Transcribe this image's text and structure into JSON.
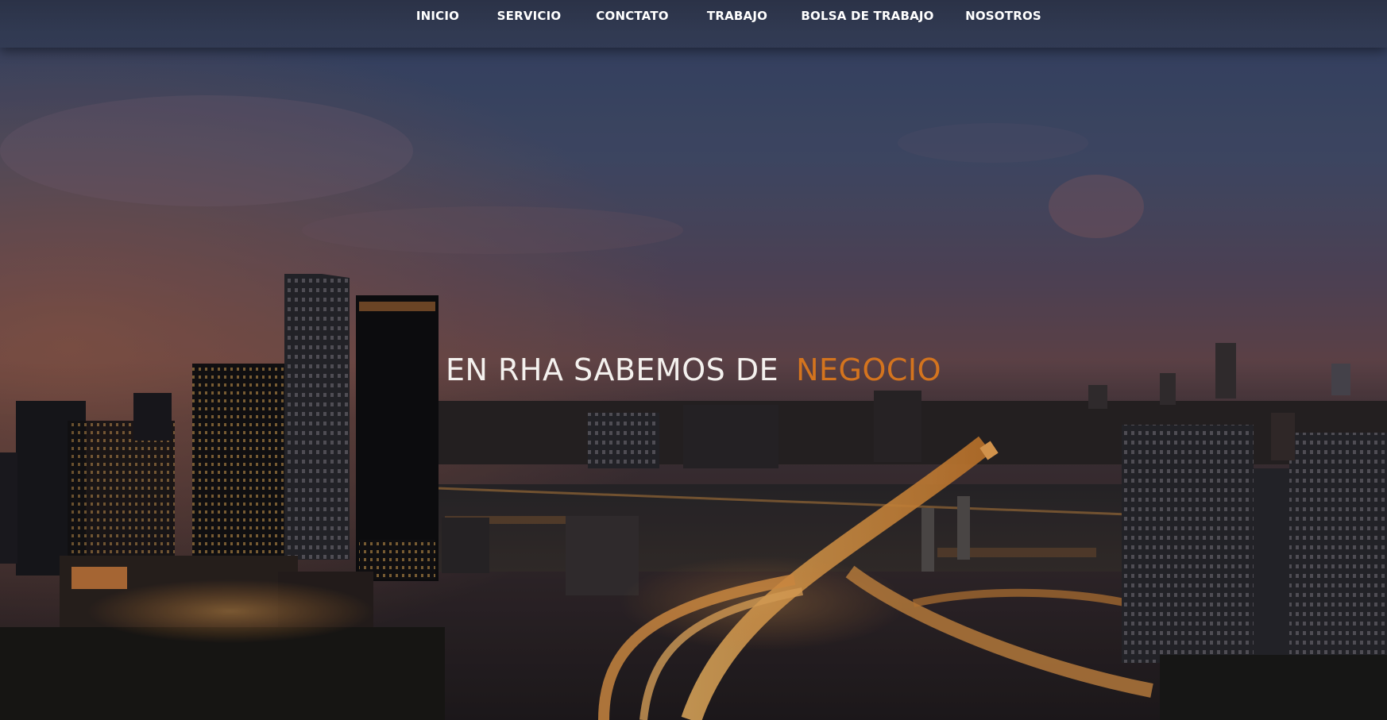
{
  "nav": {
    "items": [
      {
        "label": "INICIO"
      },
      {
        "label": "SERVICIO"
      },
      {
        "label": "CONCTATO"
      },
      {
        "label": "TRABAJO"
      },
      {
        "label": "BOLSA DE TRABAJO"
      },
      {
        "label": "NOSOTROS"
      }
    ]
  },
  "hero": {
    "headline_lead": "EN RHA SABEMOS DE",
    "headline_accent": "NEGOCIO",
    "background": "night-city-skyline-image"
  },
  "colors": {
    "accent": "#d4741e",
    "nav_background": "#313a52",
    "headline_text": "#f4f1ee"
  }
}
